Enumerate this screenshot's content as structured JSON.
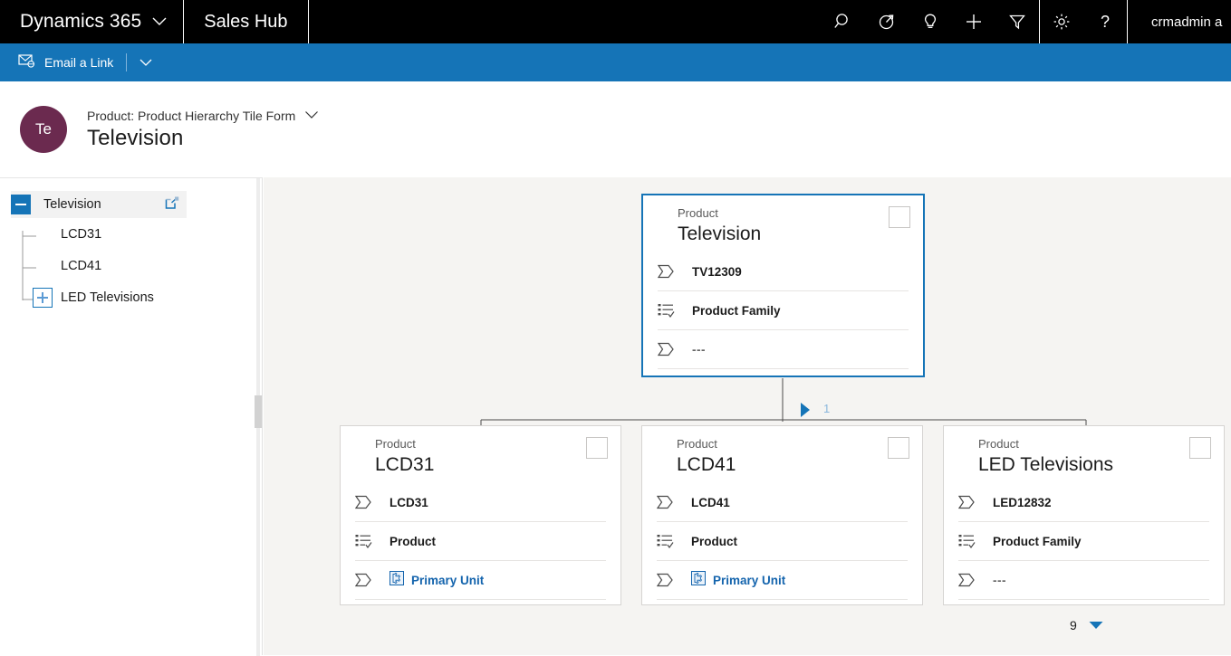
{
  "topbar": {
    "brand": "Dynamics 365",
    "app_area": "Sales Hub",
    "icons": [
      {
        "name": "search-icon",
        "label": "Search"
      },
      {
        "name": "assistant-icon",
        "label": "Assistant"
      },
      {
        "name": "lightbulb-icon",
        "label": "Relationship insights"
      },
      {
        "name": "plus-icon",
        "label": "Quick create"
      },
      {
        "name": "filter-icon",
        "label": "Filter"
      },
      {
        "name": "gear-icon",
        "label": "Settings"
      },
      {
        "name": "help-icon",
        "label": "Help"
      }
    ],
    "user": "crmadmin a",
    "background": "#000000"
  },
  "commandbar": {
    "background": "#1574b7",
    "email_link_label": "Email a Link",
    "overflow_label": ""
  },
  "record_header": {
    "avatar_initials": "Te",
    "avatar_color": "#6b2a4f",
    "form_name": "Product: Product Hierarchy Tile Form",
    "record_title": "Television"
  },
  "tree": {
    "root": {
      "label": "Television",
      "expanded": true,
      "selected": true,
      "popout_name": "open-in-new-window-icon"
    },
    "children": [
      {
        "label": "LCD31",
        "expandable": false
      },
      {
        "label": "LCD41",
        "expandable": false
      },
      {
        "label": "LED Televisions",
        "expandable": true,
        "expanded": false
      }
    ]
  },
  "hierarchy": {
    "root_card": {
      "kind": "Product",
      "title": "Television",
      "selected": true,
      "rows": [
        {
          "icon": "tag-icon",
          "text": "TV12309",
          "type": "text"
        },
        {
          "icon": "list-check-icon",
          "text": "Product Family",
          "type": "text"
        },
        {
          "icon": "tag-icon",
          "text": "---",
          "type": "muted"
        }
      ]
    },
    "child_cards": [
      {
        "kind": "Product",
        "title": "LCD31",
        "rows": [
          {
            "icon": "tag-icon",
            "text": "LCD31",
            "type": "text"
          },
          {
            "icon": "list-check-icon",
            "text": "Product",
            "type": "text"
          },
          {
            "icon": "tag-icon",
            "text": "Primary Unit",
            "type": "link",
            "link_icon": "unit-icon"
          }
        ]
      },
      {
        "kind": "Product",
        "title": "LCD41",
        "rows": [
          {
            "icon": "tag-icon",
            "text": "LCD41",
            "type": "text"
          },
          {
            "icon": "list-check-icon",
            "text": "Product",
            "type": "text"
          },
          {
            "icon": "tag-icon",
            "text": "Primary Unit",
            "type": "link",
            "link_icon": "unit-icon"
          }
        ]
      },
      {
        "kind": "Product",
        "title": "LED Televisions",
        "rows": [
          {
            "icon": "tag-icon",
            "text": "LED12832",
            "type": "text"
          },
          {
            "icon": "list-check-icon",
            "text": "Product Family",
            "type": "text"
          },
          {
            "icon": "tag-icon",
            "text": "---",
            "type": "muted"
          }
        ]
      }
    ],
    "connector_count": "1",
    "pager_value": "9",
    "accent_color": "#1574b7",
    "canvas_background": "#f5f4f2"
  }
}
